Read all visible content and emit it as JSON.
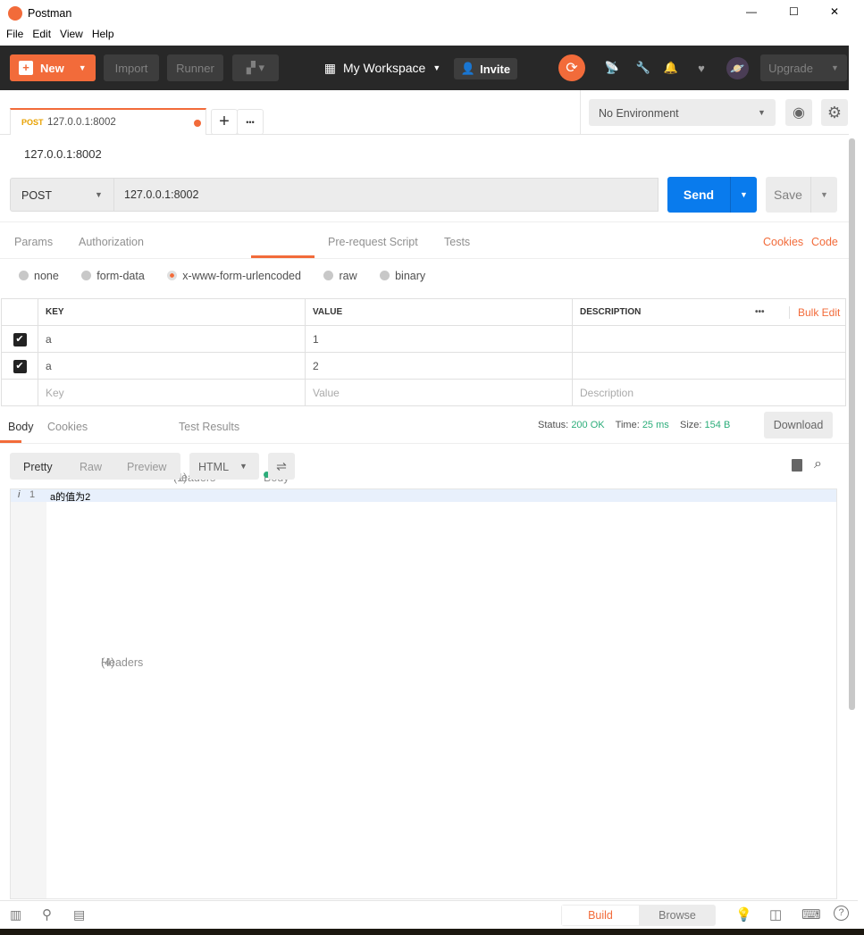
{
  "window": {
    "title": "Postman",
    "minimize": "—",
    "maximize": "☐",
    "close": "✕"
  },
  "menu": [
    "File",
    "Edit",
    "View",
    "Help"
  ],
  "header": {
    "new": "New",
    "import": "Import",
    "runner": "Runner",
    "workspace": "My Workspace",
    "invite": "Invite",
    "upgrade": "Upgrade"
  },
  "tab": {
    "method": "POST",
    "url": "127.0.0.1:8002",
    "plus": "+",
    "more": "•••"
  },
  "environment": {
    "selected": "No Environment"
  },
  "request": {
    "name": "127.0.0.1:8002",
    "method": "POST",
    "url": "127.0.0.1:8002",
    "send": "Send",
    "save": "Save"
  },
  "req_tabs": {
    "params": "Params",
    "authorization": "Authorization",
    "headers": "Headers",
    "headers_count": "(1)",
    "body": "Body",
    "prerequest": "Pre-request Script",
    "tests": "Tests",
    "cookies": "Cookies",
    "code": "Code"
  },
  "body_types": [
    "none",
    "form-data",
    "x-www-form-urlencoded",
    "raw",
    "binary"
  ],
  "kv": {
    "headers": [
      "KEY",
      "VALUE",
      "DESCRIPTION"
    ],
    "bulk_edit": "Bulk Edit",
    "more": "•••",
    "rows": [
      {
        "key": "a",
        "value": "1",
        "description": ""
      },
      {
        "key": "a",
        "value": "2",
        "description": ""
      }
    ],
    "placeholder": {
      "key": "Key",
      "value": "Value",
      "description": "Description"
    }
  },
  "response": {
    "tabs": {
      "body": "Body",
      "cookies": "Cookies",
      "headers": "Headers",
      "headers_count": "(4)",
      "tests": "Test Results"
    },
    "status_label": "Status:",
    "status": "200 OK",
    "time_label": "Time:",
    "time": "25 ms",
    "size_label": "Size:",
    "size": "154 B",
    "download": "Download",
    "views": [
      "Pretty",
      "Raw",
      "Preview"
    ],
    "format": "HTML",
    "line_no": "1",
    "line_icon": "i",
    "content": "a的值为2"
  },
  "footer": {
    "build": "Build",
    "browse": "Browse"
  }
}
